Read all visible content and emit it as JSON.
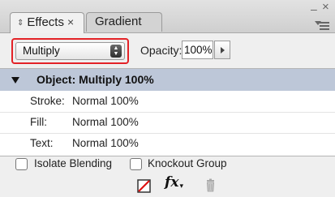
{
  "tabs": [
    {
      "label": "Effects",
      "arrows_glyph": "⇕",
      "close_glyph": "×",
      "active": true
    },
    {
      "label": "Gradient",
      "active": false
    }
  ],
  "window": {
    "minimize_glyph": "–",
    "close_glyph": "×"
  },
  "blend_mode": {
    "value": "Multiply",
    "stepper_glyph": "▲▼"
  },
  "opacity": {
    "label": "Opacity:",
    "value": "100%"
  },
  "list": {
    "object": {
      "text": "Object: Multiply 100%"
    },
    "rows": [
      {
        "label": "Stroke:",
        "value": "Normal 100%"
      },
      {
        "label": "Fill:",
        "value": "Normal 100%"
      },
      {
        "label": "Text:",
        "value": "Normal 100%"
      }
    ]
  },
  "options": {
    "isolate_blending": {
      "label": "Isolate Blending",
      "checked": false
    },
    "knockout_group": {
      "label": "Knockout Group",
      "checked": false
    }
  },
  "footer": {
    "fx_label": "fx",
    "icons": [
      "clear-effects-icon",
      "fx-menu-icon",
      "trash-icon"
    ]
  },
  "colors": {
    "highlight_outline": "#e32227",
    "selected_row": "#bdc7d8",
    "panel_bg": "#efefef"
  }
}
